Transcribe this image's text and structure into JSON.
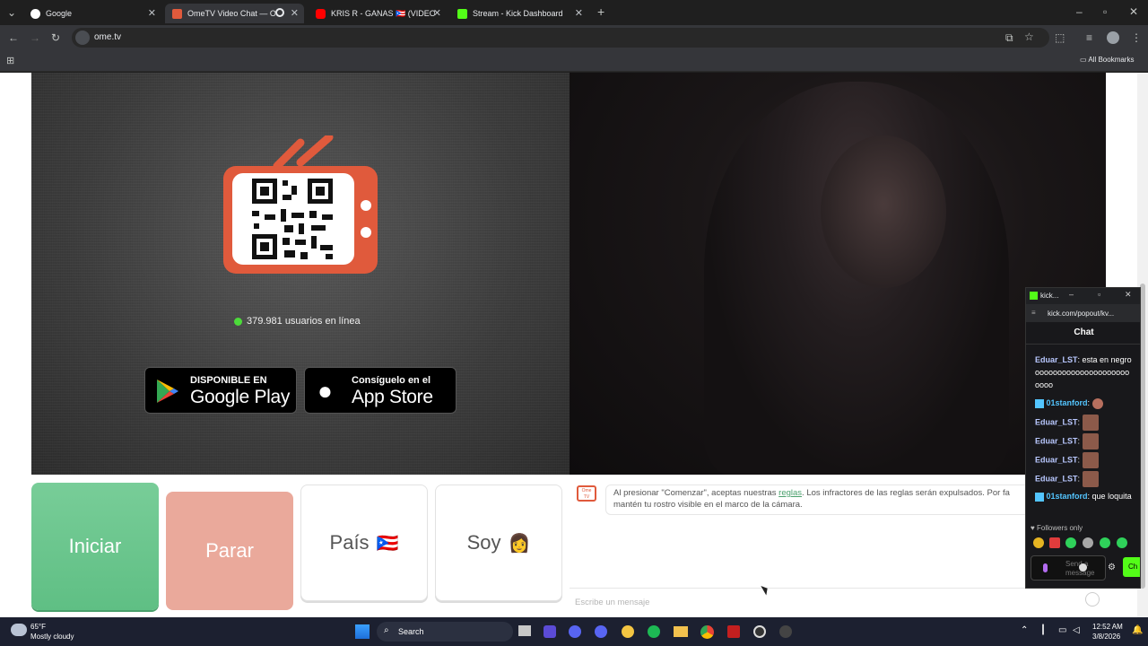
{
  "tabs": [
    {
      "label": "Google",
      "active": false,
      "color": "#ffffff"
    },
    {
      "label": "OmeTV Video Chat — Ome",
      "active": true,
      "color": "#e05a3c"
    },
    {
      "label": "KRIS R - GANAS 🇵🇷 (VIDEO OF",
      "active": false,
      "color": "#ff0000"
    },
    {
      "label": "Stream - Kick Dashboard",
      "active": false,
      "color": "#53fc18"
    }
  ],
  "address": {
    "url": "ome.tv"
  },
  "bookmarks": {
    "all_label": "All Bookmarks"
  },
  "ometv": {
    "users_online": "379.981 usuarios en línea",
    "google_play_small": "DISPONIBLE EN",
    "google_play_big": "Google Play",
    "app_store_small": "Consíguelo en el",
    "app_store_big": "App Store",
    "buttons": {
      "start": "Iniciar",
      "stop": "Parar",
      "country": "País",
      "country_flag": "🇵🇷",
      "gender": "Soy",
      "gender_emoji": "👩"
    },
    "notice_part1": "Al presionar \"Comenzar\", aceptas nuestras ",
    "notice_link": "reglas",
    "notice_part2": ". Los infractores de las reglas serán expulsados. Por fa",
    "notice_line2": "mantén tu rostro visible en el marco de la cámara.",
    "message_placeholder": "Escribe un mensaje",
    "logo_label": "Ome TV"
  },
  "kick": {
    "window_title": "kick...",
    "url": "kick.com/popout/kv...",
    "header": "Chat",
    "messages": [
      {
        "user": "Eduar_LST",
        "text": "esta en negroooooooooooooooooooooooooo",
        "badge": false
      },
      {
        "user": "01stanford",
        "text": "",
        "badge": true,
        "emote": true
      },
      {
        "user": "Eduar_LST",
        "text": "",
        "badge": false,
        "emote": true
      },
      {
        "user": "Eduar_LST",
        "text": "",
        "badge": false,
        "emote": true
      },
      {
        "user": "Eduar_LST",
        "text": "",
        "badge": false,
        "emote": true
      },
      {
        "user": "Eduar_LST",
        "text": "",
        "badge": false,
        "emote": true
      },
      {
        "user": "01stanford",
        "text": "que loquita",
        "badge": true
      }
    ],
    "followers_only": "Followers only",
    "send_placeholder": "Send a message",
    "chat_button": "Ch"
  },
  "taskbar": {
    "temp": "65°F",
    "weather": "Mostly cloudy",
    "search": "Search",
    "time": "12:52 AM",
    "date": "3/8/2026"
  },
  "colors": {
    "start": "#6cc58f",
    "stop": "#eaa99b",
    "ometv_red": "#e05a3c",
    "kick_green": "#53fc18"
  }
}
